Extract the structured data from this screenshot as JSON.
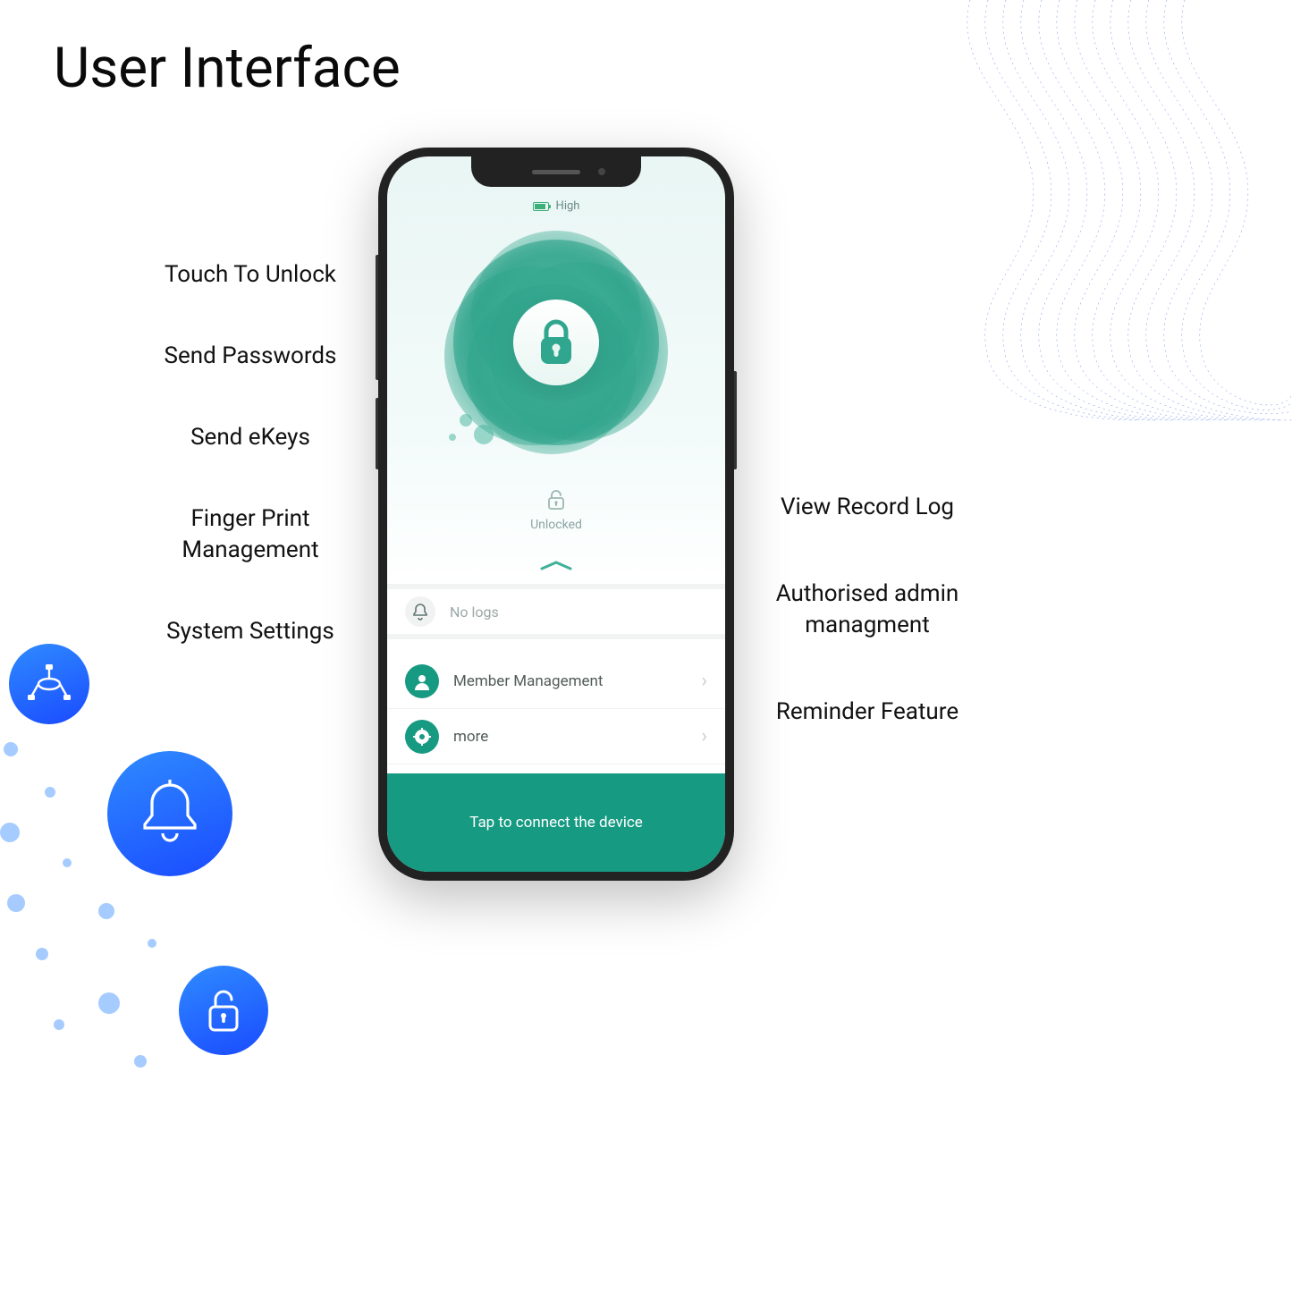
{
  "page": {
    "title": "User Interface"
  },
  "left_features": [
    "Touch To Unlock",
    "Send Passwords",
    "Send eKeys",
    "Finger Print Management",
    "System Settings"
  ],
  "right_features": [
    "View Record Log",
    "Authorised admin managment",
    "Reminder Feature"
  ],
  "phone": {
    "battery_label": "High",
    "lock_status": "Unlocked",
    "logs_text": "No logs",
    "list": {
      "member_management": "Member Management",
      "more": "more"
    },
    "connect_button": "Tap to connect the device"
  },
  "icons": {
    "decor": {
      "network": "network-icon",
      "bell": "bell-icon",
      "lock": "lock-open-icon"
    }
  },
  "colors": {
    "accent_teal": "#179a82",
    "accent_blue_gradient_from": "#2f8bff",
    "accent_blue_gradient_to": "#1a4bff"
  }
}
